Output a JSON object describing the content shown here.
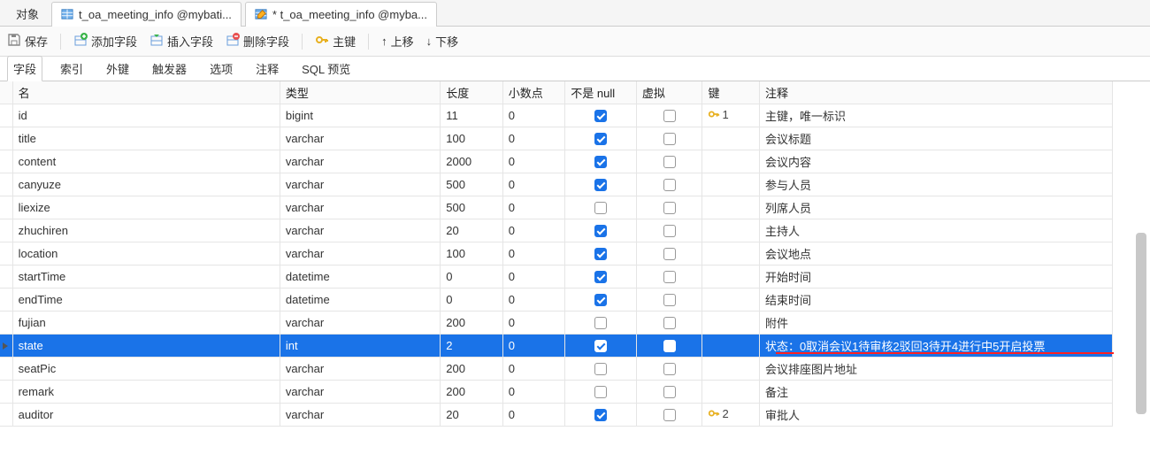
{
  "topTabs": {
    "obj": "对象",
    "tab1": "t_oa_meeting_info @mybati...",
    "tab2": "* t_oa_meeting_info @myba..."
  },
  "toolbar": {
    "save": "保存",
    "addField": "添加字段",
    "insertField": "插入字段",
    "deleteField": "删除字段",
    "primaryKey": "主键",
    "moveUp": "上移",
    "moveDown": "下移"
  },
  "subTabs": {
    "fields": "字段",
    "indexes": "索引",
    "fkeys": "外键",
    "triggers": "触发器",
    "options": "选项",
    "comment": "注释",
    "sqlPreview": "SQL 预览"
  },
  "headers": {
    "name": "名",
    "type": "类型",
    "length": "长度",
    "decimals": "小数点",
    "notNull": "不是 null",
    "virtual": "虚拟",
    "key": "键",
    "comment": "注释"
  },
  "rows": [
    {
      "name": "id",
      "type": "bigint",
      "length": "11",
      "decimals": "0",
      "notNull": true,
      "virtual": false,
      "key": "1",
      "comment": "主键，唯一标识",
      "selected": false
    },
    {
      "name": "title",
      "type": "varchar",
      "length": "100",
      "decimals": "0",
      "notNull": true,
      "virtual": false,
      "key": "",
      "comment": "会议标题",
      "selected": false
    },
    {
      "name": "content",
      "type": "varchar",
      "length": "2000",
      "decimals": "0",
      "notNull": true,
      "virtual": false,
      "key": "",
      "comment": "会议内容",
      "selected": false
    },
    {
      "name": "canyuze",
      "type": "varchar",
      "length": "500",
      "decimals": "0",
      "notNull": true,
      "virtual": false,
      "key": "",
      "comment": "参与人员",
      "selected": false
    },
    {
      "name": "liexize",
      "type": "varchar",
      "length": "500",
      "decimals": "0",
      "notNull": false,
      "virtual": false,
      "key": "",
      "comment": "列席人员",
      "selected": false
    },
    {
      "name": "zhuchiren",
      "type": "varchar",
      "length": "20",
      "decimals": "0",
      "notNull": true,
      "virtual": false,
      "key": "",
      "comment": "主持人",
      "selected": false
    },
    {
      "name": "location",
      "type": "varchar",
      "length": "100",
      "decimals": "0",
      "notNull": true,
      "virtual": false,
      "key": "",
      "comment": "会议地点",
      "selected": false
    },
    {
      "name": "startTime",
      "type": "datetime",
      "length": "0",
      "decimals": "0",
      "notNull": true,
      "virtual": false,
      "key": "",
      "comment": "开始时间",
      "selected": false
    },
    {
      "name": "endTime",
      "type": "datetime",
      "length": "0",
      "decimals": "0",
      "notNull": true,
      "virtual": false,
      "key": "",
      "comment": "结束时间",
      "selected": false
    },
    {
      "name": "fujian",
      "type": "varchar",
      "length": "200",
      "decimals": "0",
      "notNull": false,
      "virtual": false,
      "key": "",
      "comment": "附件",
      "selected": false
    },
    {
      "name": "state",
      "type": "int",
      "length": "2",
      "decimals": "0",
      "notNull": true,
      "virtual": false,
      "key": "",
      "comment": "状态：0取消会议1待审核2驳回3待开4进行中5开启投票",
      "selected": true
    },
    {
      "name": "seatPic",
      "type": "varchar",
      "length": "200",
      "decimals": "0",
      "notNull": false,
      "virtual": false,
      "key": "",
      "comment": "会议排座图片地址",
      "selected": false
    },
    {
      "name": "remark",
      "type": "varchar",
      "length": "200",
      "decimals": "0",
      "notNull": false,
      "virtual": false,
      "key": "",
      "comment": "备注",
      "selected": false
    },
    {
      "name": "auditor",
      "type": "varchar",
      "length": "20",
      "decimals": "0",
      "notNull": true,
      "virtual": false,
      "key": "2",
      "comment": "审批人",
      "selected": false
    }
  ]
}
